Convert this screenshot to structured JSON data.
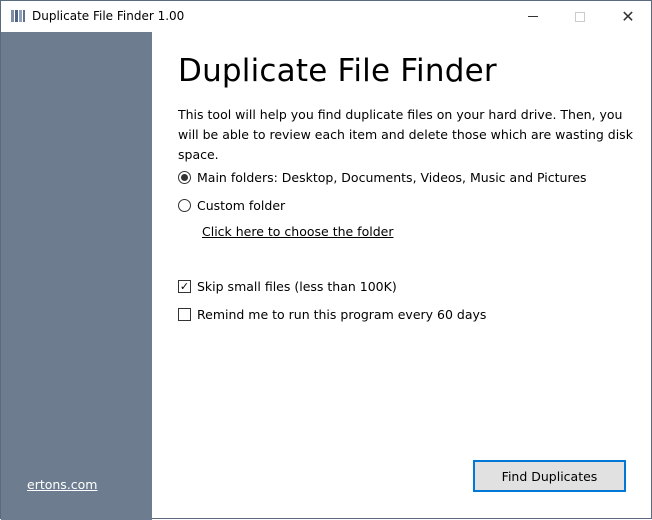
{
  "window": {
    "title": "Duplicate File Finder 1.00",
    "controls": {
      "minimize": "minimize",
      "maximize": "maximize",
      "close": "✕"
    }
  },
  "sidebar": {
    "link": "ertons.com"
  },
  "main": {
    "heading": "Duplicate File Finder",
    "description": "This tool will help you find duplicate files on your hard drive. Then, you will be able to review each item and delete those which are wasting disk space.",
    "options": [
      {
        "label": "Main folders: Desktop, Documents, Videos, Music and Pictures",
        "selected": true
      },
      {
        "label": "Custom folder",
        "selected": false
      }
    ],
    "choose_folder_link": "Click here to choose the folder",
    "checkboxes": [
      {
        "label": "Skip small files (less than 100K)",
        "checked": true,
        "mark": "✓"
      },
      {
        "label": "Remind me to run this program every 60 days",
        "checked": false
      }
    ],
    "find_button": "Find Duplicates"
  }
}
